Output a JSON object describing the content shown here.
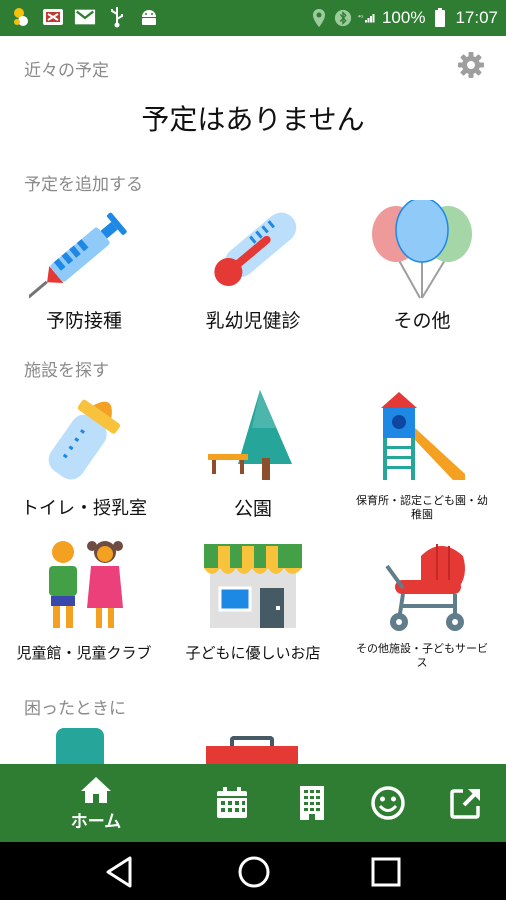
{
  "status_bar": {
    "battery": "100%",
    "time": "17:07",
    "icons_left": [
      "app-icon",
      "image-icon",
      "mail-icon",
      "usb-icon",
      "android-icon"
    ],
    "icons_right": [
      "location-icon",
      "bluetooth-icon",
      "signal-icon",
      "battery-icon"
    ]
  },
  "upcoming": {
    "label": "近々の予定",
    "empty_message": "予定はありません"
  },
  "sections": {
    "add_schedule": "予定を追加する",
    "find_facility": "施設を探す",
    "trouble": "困ったときに"
  },
  "add_items": [
    {
      "label": "予防接種",
      "icon": "syringe-icon"
    },
    {
      "label": "乳幼児健診",
      "icon": "thermometer-icon"
    },
    {
      "label": "その他",
      "icon": "balloons-icon"
    }
  ],
  "facility_items": [
    {
      "label": "トイレ・授乳室",
      "icon": "baby-bottle-icon"
    },
    {
      "label": "公園",
      "icon": "park-icon"
    },
    {
      "label": "保育所・認定こども園・幼稚園",
      "icon": "playground-slide-icon"
    },
    {
      "label": "児童館・児童クラブ",
      "icon": "children-icon"
    },
    {
      "label": "子どもに優しいお店",
      "icon": "shop-icon"
    },
    {
      "label": "その他施設・子どもサービス",
      "icon": "stroller-icon"
    }
  ],
  "bottom_nav": {
    "home_label": "ホーム",
    "items": [
      "home-icon",
      "calendar-icon",
      "building-icon",
      "smiley-icon",
      "external-link-icon"
    ]
  },
  "colors": {
    "primary": "#2e7d32",
    "section_gray": "#8a8a8a"
  }
}
